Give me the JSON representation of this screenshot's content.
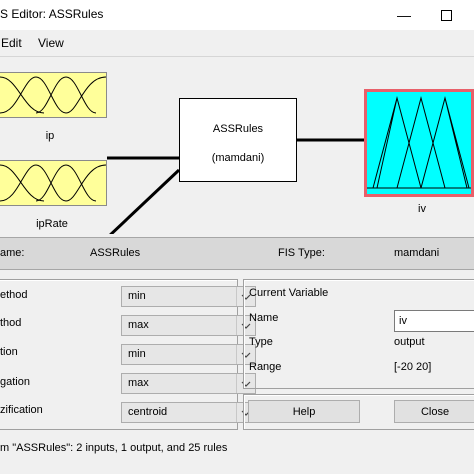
{
  "window": {
    "title": "S Editor: ASSRules",
    "minimize_glyph": "—",
    "close_glyph": "✕"
  },
  "menu": [
    {
      "label": "Edit"
    },
    {
      "label": "View"
    }
  ],
  "inputs": [
    {
      "name": "ip"
    },
    {
      "name": "ipRate"
    }
  ],
  "system": {
    "name": "ASSRules",
    "type": "(mamdani)"
  },
  "output": {
    "name": "iv"
  },
  "info": {
    "name_label": "ame:",
    "name_value": "ASSRules",
    "type_label": "FIS Type:",
    "type_value": "mamdani"
  },
  "methods": [
    {
      "label": "ethod",
      "value": "min"
    },
    {
      "label": "thod",
      "value": "max"
    },
    {
      "label": "tion",
      "value": "min"
    },
    {
      "label": "gation",
      "value": "max"
    },
    {
      "label": "zification",
      "value": "centroid"
    }
  ],
  "current_variable": {
    "heading": "Current Variable",
    "name_label": "Name",
    "name_value": "iv",
    "type_label": "Type",
    "type_value": "output",
    "range_label": "Range",
    "range_value": "[-20 20]"
  },
  "buttons": {
    "help": "Help",
    "close": "Close"
  },
  "status": "m \"ASSRules\": 2 inputs, 1 output, and 25 rules",
  "colors": {
    "input_fill": "#ffff9a",
    "output_fill": "#00ffff",
    "output_border": "#e8606a"
  }
}
